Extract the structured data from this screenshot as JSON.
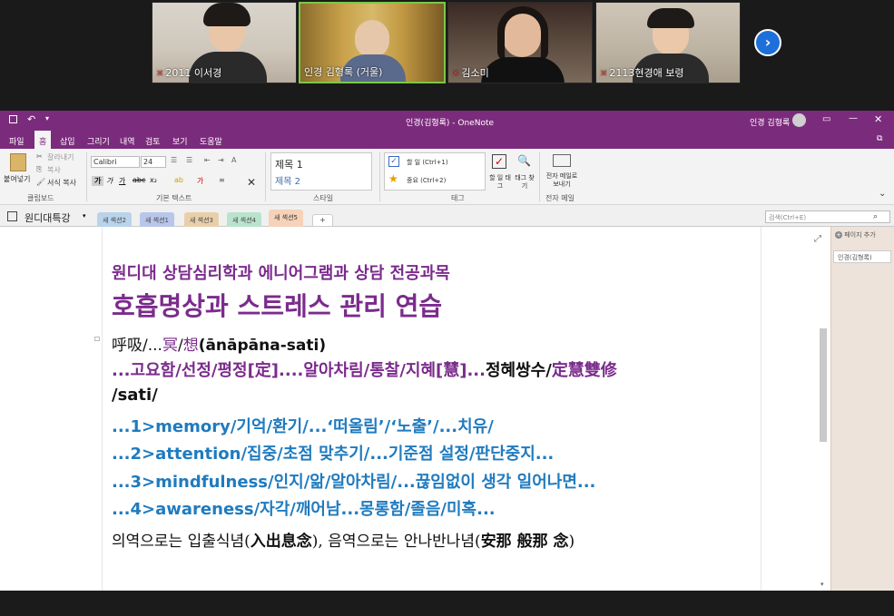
{
  "video": {
    "participants": [
      {
        "label": "2011 이서경",
        "muted": true
      },
      {
        "label": "인경 김형록 (거울)",
        "muted": false
      },
      {
        "label": "김소미",
        "muted": true
      },
      {
        "label": "2113현경애 보령",
        "muted": true
      }
    ],
    "next_glyph": "›"
  },
  "window": {
    "title": "인경(김형록) - OneNote",
    "user": "인경 김형록"
  },
  "menu": [
    "파일",
    "홈",
    "삽입",
    "그리기",
    "내역",
    "검토",
    "보기",
    "도움말"
  ],
  "ribbon": {
    "clipboard": {
      "paste": "붙여넣기",
      "cut": "잘라내기",
      "copy": "복사",
      "format_painter": "서식 복사",
      "label": "클립보드"
    },
    "basic_text": {
      "font": "Calibri",
      "size": "24",
      "label": "기본 텍스트"
    },
    "styles": {
      "h1": "제목 1",
      "h2": "제목 2",
      "label": "스타일"
    },
    "tags": {
      "todo": "할 일 (Ctrl+1)",
      "important": "중요 (Ctrl+2)",
      "todo_tag": "할 일 태그",
      "find_tags": "태그 찾기",
      "label": "태그"
    },
    "email": {
      "send": "전자 메일로 보내기",
      "label": "전자 메일"
    }
  },
  "notebook": {
    "name": "원디대특강",
    "sections": [
      "새 섹션2",
      "새 섹션1",
      "새 섹션3",
      "새 섹션4",
      "새 섹션5"
    ],
    "add_section": "+",
    "search_placeholder": "검색(Ctrl+E)"
  },
  "pages_panel": {
    "add_page": "페이지 추가",
    "page": "인경(김형록)"
  },
  "content": {
    "subtitle": "원디대 상담심리학과 에니어그램과 상담 전공과목",
    "title": "호흡명상과 스트레스 관리 연습",
    "l1_a": "呼吸/...",
    "l1_b": "冥",
    "l1_c": "/",
    "l1_d": "想",
    "l1_e": "(ānāpāna-sati)",
    "l2_a": "...고요함/선정/평정[定]....알아차림/통찰/지혜[慧]...",
    "l2_b": "정혜쌍수/",
    "l2_c": "定慧雙修",
    "l3": "/sati/",
    "l4": "...1>memory/기억/환기/...‘떠올림’/‘노출’/...치유/",
    "l5": "...2>attention/집중/초점 맞추기/...기준점 설정/판단중지...",
    "l6": "...3>mindfulness/인지/앎/알아차림/...끊임없이 생각 일어나면...",
    "l7": "...4>awareness/자각/깨어남...몽롱함/졸음/미혹...",
    "l8_a": "의역으로는 입출식념(",
    "l8_b": "入出息念",
    "l8_c": "), 음역으로는 안나반나념(",
    "l8_d": "安那 般那 念",
    "l8_e": ")"
  },
  "colors": {
    "onenote_purple": "#7b2b7c",
    "text_purple": "#7b2b8c",
    "text_blue": "#1f7bbf"
  }
}
